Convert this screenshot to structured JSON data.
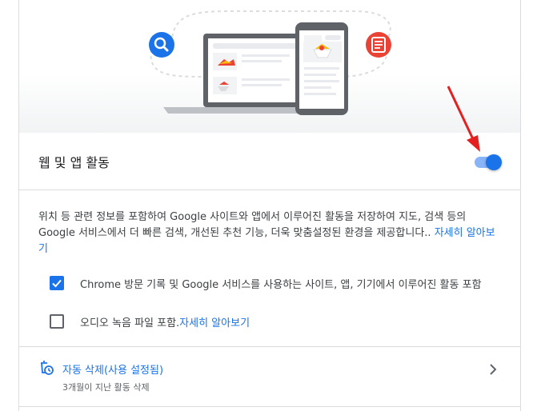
{
  "section": {
    "title": "웹 및 앱 활동",
    "toggle_state": "on"
  },
  "description": {
    "text": "위치 등 관련 정보를 포함하여 Google 사이트와 앱에서 이루어진 활동을 저장하여 지도, 검색 등의 Google 서비스에서 더 빠른 검색, 개선된 추천 기능, 더욱 맞춤설정된 환경을 제공합니다.. ",
    "learn_more": "자세히 알아보기"
  },
  "options": [
    {
      "label": "Chrome 방문 기록 및 Google 서비스를 사용하는 사이트, 앱, 기기에서 이루어진 활동 포함",
      "checked": true
    },
    {
      "label": "오디오 녹음 파일 포함. ",
      "link": "자세히 알아보기",
      "checked": false
    }
  ],
  "auto_delete": {
    "title": "자동 삭제(사용 설정됨)",
    "subtitle": "3개월이 지난 활동 삭제"
  },
  "colors": {
    "accent": "#1a73e8",
    "toggle_track": "#8ab4f8",
    "red_icon": "#ea4335",
    "annotation_arrow": "#e52020"
  }
}
